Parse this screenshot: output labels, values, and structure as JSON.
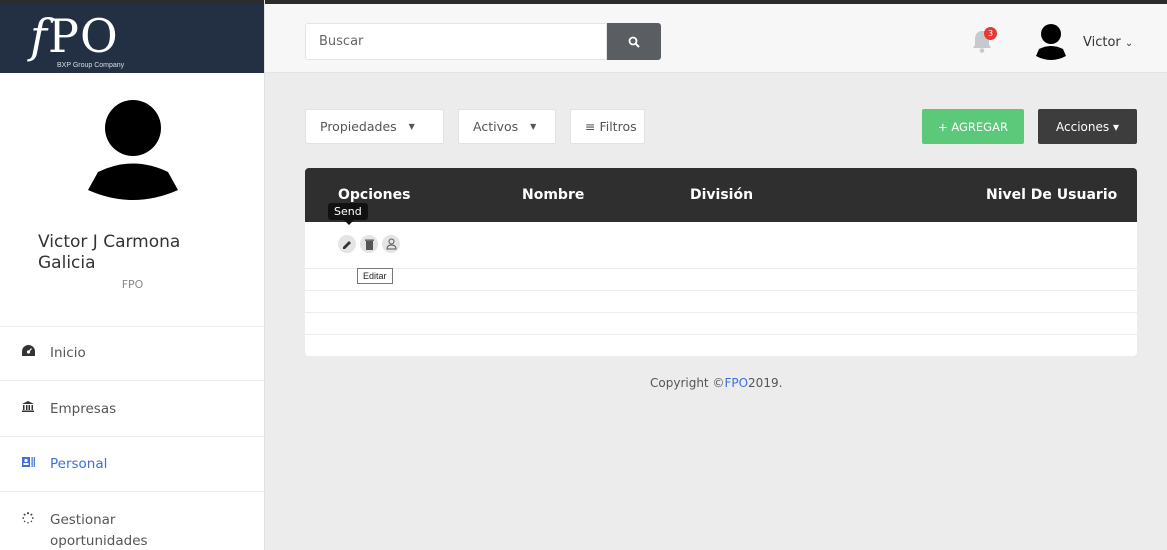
{
  "brand": {
    "logo_text_f": "f",
    "logo_text_rest": "PO",
    "logo_subtitle": "BXP Group Company"
  },
  "sidebar": {
    "user_name": "Victor J Carmona Galicia",
    "user_org": "FPO",
    "nav": [
      {
        "label": "Inicio",
        "icon": "dashboard-icon"
      },
      {
        "label": "Empresas",
        "icon": "bank-icon"
      },
      {
        "label": "Personal",
        "icon": "id-card-icon",
        "active": true
      },
      {
        "label": "Gestionar oportunidades",
        "icon": "spinner-icon"
      }
    ]
  },
  "topbar": {
    "search_placeholder": "Buscar",
    "notification_count": "3",
    "user_label": "Victor",
    "user_caret": "⌄"
  },
  "toolbar": {
    "filter_properties": "Propiedades",
    "filter_status": "Activos",
    "filters_button": "≡ Filtros",
    "add_button": "+ AGREGAR",
    "actions_button": "Acciones ▾"
  },
  "table": {
    "columns": [
      "Opciones",
      "Nombre",
      "División",
      "Nivel De Usuario"
    ]
  },
  "tooltips": {
    "send": "Send",
    "edit": "Editar"
  },
  "footer": {
    "prefix": "Copyright ©",
    "brand": "FPO",
    "year": "2019."
  },
  "colors": {
    "accent_blue": "#3f6fd8",
    "add_green": "#5cc97a",
    "dark": "#2f2f2f",
    "sidebar_logo_bg": "#233044"
  }
}
